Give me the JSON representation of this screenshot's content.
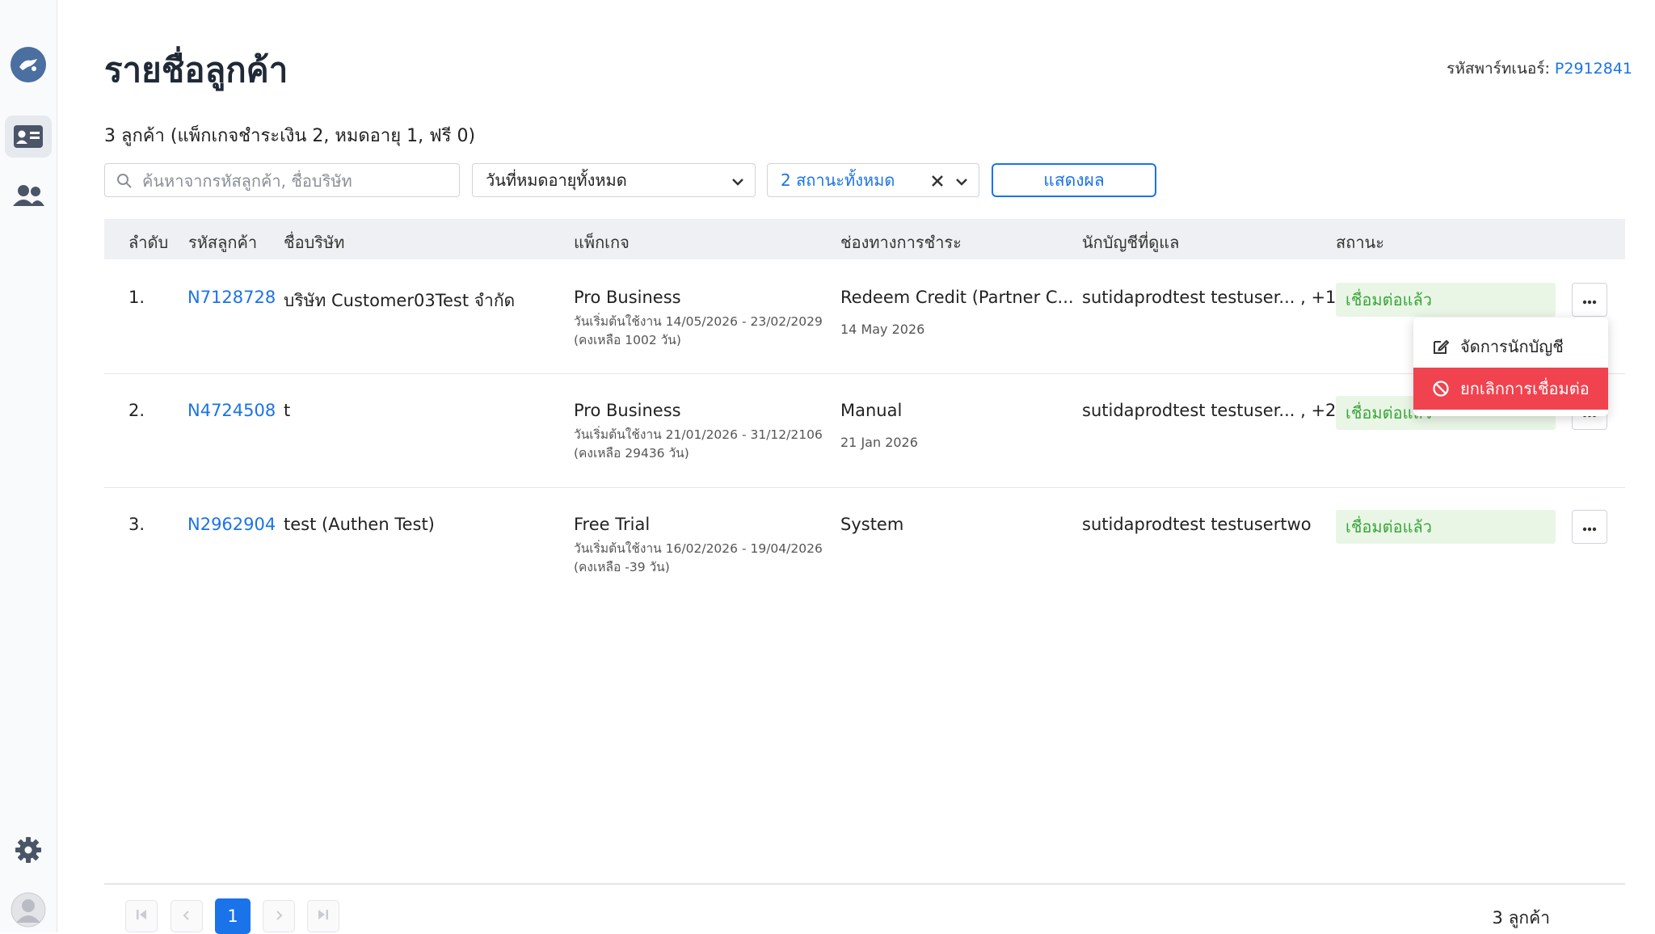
{
  "header": {
    "title": "รายชื่อลูกค้า",
    "partner_label": "รหัสพาร์ทเนอร์:",
    "partner_code": "P2912841",
    "summary": "3 ลูกค้า (แพ็กเกจชำระเงิน 2, หมดอายุ 1, ฟรี 0)"
  },
  "filters": {
    "search_placeholder": "ค้นหาจากรหัสลูกค้า, ชื่อบริษัท",
    "expiry_select": "วันที่หมดอายุทั้งหมด",
    "status_select": "2 สถานะทั้งหมด",
    "show_button": "แสดงผล"
  },
  "table": {
    "columns": [
      "ลำดับ",
      "รหัสลูกค้า",
      "ชื่อบริษัท",
      "แพ็กเกจ",
      "ช่องทางการชำระ",
      "นักบัญชีที่ดูแล",
      "สถานะ"
    ],
    "rows": [
      {
        "num": "1.",
        "code": "N7128728",
        "company": "บริษัท Customer03Test จำกัด",
        "package": "Pro Business",
        "package_range": "วันเริ่มต้นใช้งาน 14/05/2026 - 23/02/2029",
        "package_remain": "(คงเหลือ 1002 วัน)",
        "payment": "Redeem Credit (Partner C...",
        "payment_date": "14 May 2026",
        "accountant": "sutidaprodtest testuser... , +1",
        "status": "เชื่อมต่อแล้ว"
      },
      {
        "num": "2.",
        "code": "N4724508",
        "company": "t",
        "package": "Pro Business",
        "package_range": "วันเริ่มต้นใช้งาน 21/01/2026 - 31/12/2106",
        "package_remain": "(คงเหลือ 29436 วัน)",
        "payment": "Manual",
        "payment_date": "21 Jan 2026",
        "accountant": "sutidaprodtest testuser... , +2",
        "status": "เชื่อมต่อแล้ว"
      },
      {
        "num": "3.",
        "code": "N2962904",
        "company": "test (Authen Test)",
        "package": "Free Trial",
        "package_range": "วันเริ่มต้นใช้งาน 16/02/2026 - 19/04/2026",
        "package_remain": "(คงเหลือ -39 วัน)",
        "payment": "System",
        "payment_date": "",
        "accountant": "sutidaprodtest testusertwo",
        "status": "เชื่อมต่อแล้ว"
      }
    ]
  },
  "context_menu": {
    "manage_accountant": "จัดการนักบัญชี",
    "disconnect": "ยกเลิกการเชื่อมต่อ"
  },
  "pagination": {
    "current_page": "1",
    "total": "3 ลูกค้า"
  },
  "colors": {
    "accent": "#1a73e8",
    "success_bg": "#e9f6e6",
    "success_text": "#3aa53a",
    "danger": "#f0434f"
  },
  "icons": [
    "logo-icon",
    "contact-card-icon",
    "users-icon",
    "gear-icon",
    "avatar-icon",
    "search-icon",
    "chevron-down-icon",
    "clear-icon",
    "more-icon",
    "edit-icon",
    "ban-icon",
    "first-page-icon",
    "prev-page-icon",
    "next-page-icon",
    "last-page-icon"
  ]
}
